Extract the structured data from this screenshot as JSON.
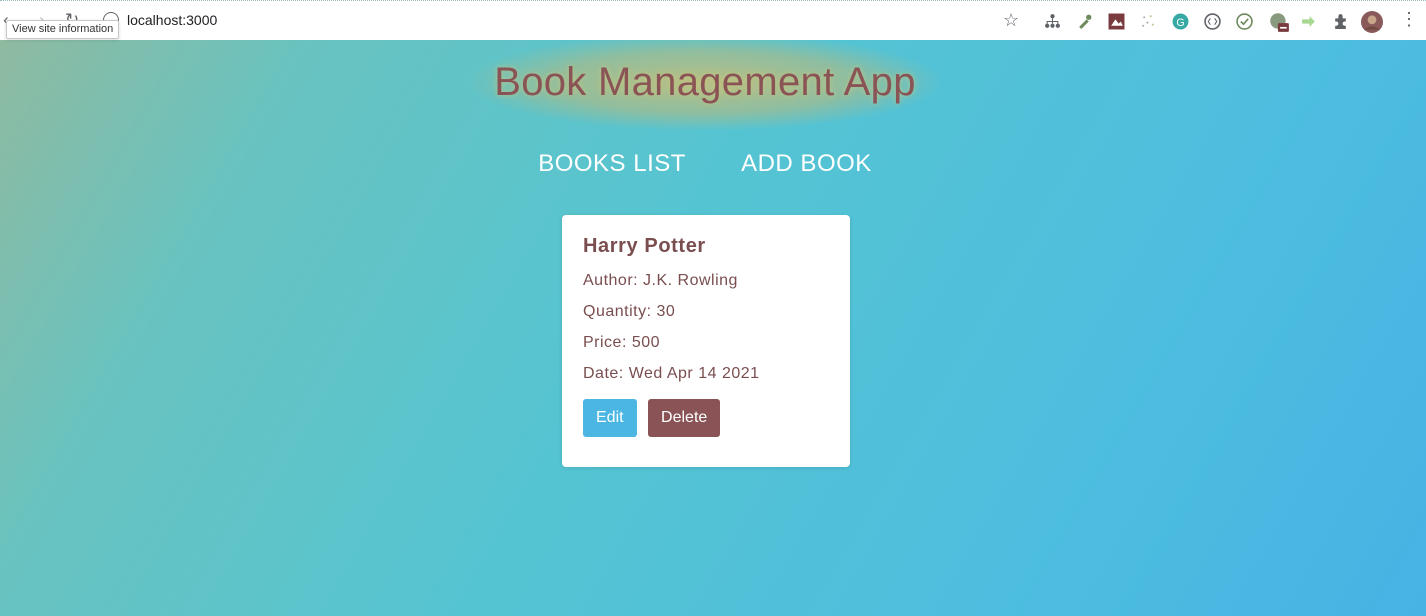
{
  "browser": {
    "url": "localhost:3000",
    "tooltip": "View site information",
    "icons": [
      "back-icon",
      "forward-icon",
      "reload-icon",
      "site-info-icon",
      "star-icon",
      "extensions-icon",
      "menu-icon"
    ]
  },
  "app": {
    "title": "Book Management App",
    "accent": "#8a5456",
    "primary": "#4bb6e2"
  },
  "nav": {
    "books_list": "BOOKS LIST",
    "add_book": "ADD BOOK"
  },
  "book": {
    "title": "Harry Potter",
    "author": "Author: J.K. Rowling",
    "quantity": "Quantity: 30",
    "price": "Price: 500",
    "date": "Date: Wed Apr 14 2021",
    "edit_label": "Edit",
    "delete_label": "Delete"
  }
}
